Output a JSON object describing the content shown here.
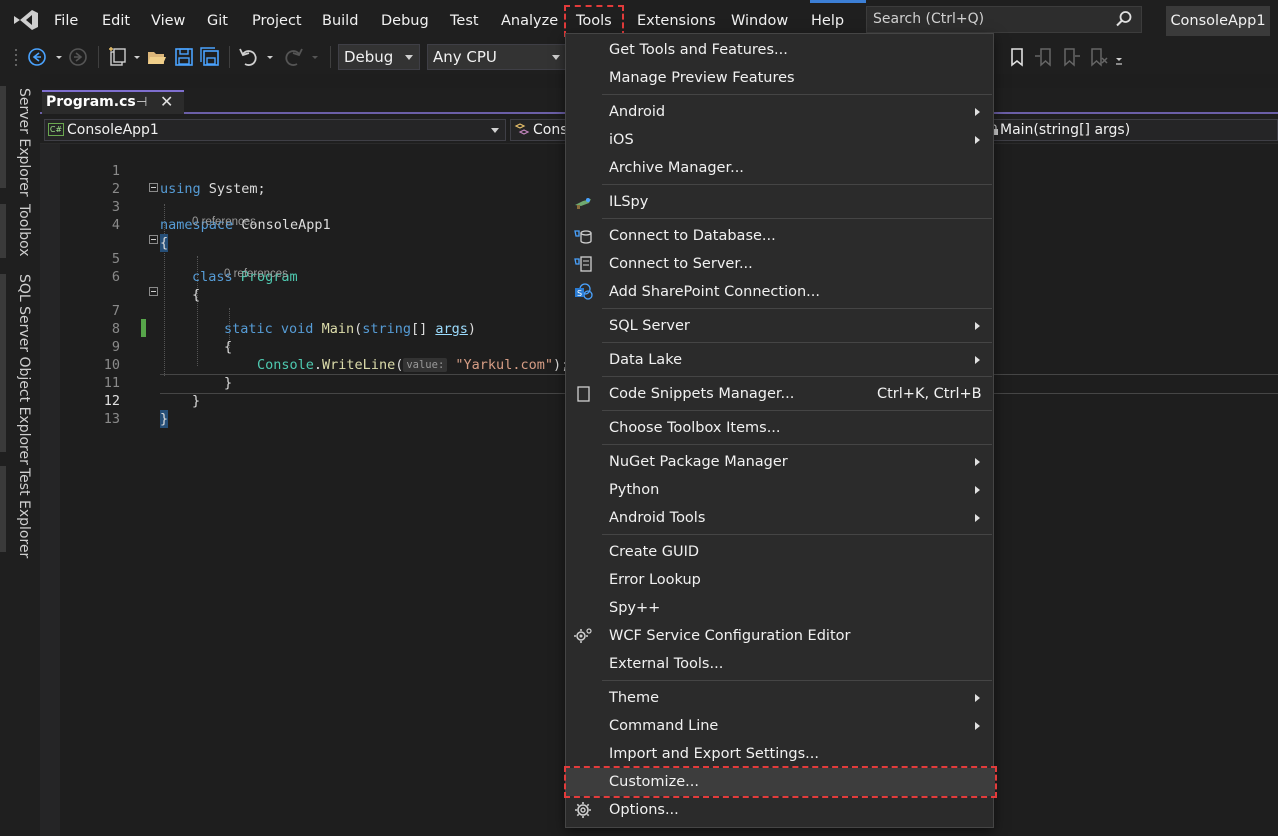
{
  "menubar": {
    "items": [
      "File",
      "Edit",
      "View",
      "Git",
      "Project",
      "Build",
      "Debug",
      "Test",
      "Analyze",
      "Tools",
      "Extensions",
      "Window",
      "Help"
    ],
    "search_placeholder": "Search (Ctrl+Q)",
    "solution_name": "ConsoleApp1"
  },
  "toolbar": {
    "config": "Debug",
    "platform": "Any CPU"
  },
  "side_tabs": [
    "Server Explorer",
    "Toolbox",
    "SQL Server Object Explorer",
    "Test Explorer"
  ],
  "document_tab": {
    "title": "Program.cs"
  },
  "navbar": {
    "project": "ConsoleApp1",
    "type": "Consc",
    "member": "Main(string[] args)"
  },
  "editor": {
    "line_numbers": [
      "1",
      "2",
      "3",
      "4",
      "5",
      "6",
      "7",
      "8",
      "9",
      "10",
      "11",
      "12",
      "13"
    ],
    "codelens": "0 references",
    "hint_label": "value:",
    "lines": {
      "l1_kw": "using",
      "l1_rest": " System;",
      "l3_kw": "namespace",
      "l3_rest": " ConsoleApp1",
      "l4": "{",
      "l5_kw": "class",
      "l5_type": "Program",
      "l6": "{",
      "l7_kw1": "static",
      "l7_kw2": "void",
      "l7_fn": "Main",
      "l7_p1": "(",
      "l7_kw3": "string",
      "l7_p2": "[] ",
      "l7_pm": "args",
      "l7_p3": ")",
      "l8": "{",
      "l9_ty": "Console",
      "l9_dot": ".",
      "l9_fn": "WriteLine",
      "l9_p1": "(",
      "l9_str": "\"Yarkul.com\"",
      "l9_p2": ");",
      "l10": "}",
      "l11": "}",
      "l12": "}"
    }
  },
  "tools_menu": {
    "get_tools": "Get Tools and Features...",
    "manage_preview": "Manage Preview Features",
    "android": "Android",
    "ios": "iOS",
    "archive": "Archive Manager...",
    "ilspy": "ILSpy",
    "connect_db": "Connect to Database...",
    "connect_server": "Connect to Server...",
    "sharepoint": "Add SharePoint Connection...",
    "sql_server": "SQL Server",
    "data_lake": "Data Lake",
    "snippets": "Code Snippets Manager...",
    "snippets_shortcut": "Ctrl+K, Ctrl+B",
    "toolbox_items": "Choose Toolbox Items...",
    "nuget": "NuGet Package Manager",
    "python": "Python",
    "android_tools": "Android Tools",
    "guid": "Create GUID",
    "error_lookup": "Error Lookup",
    "spy": "Spy++",
    "wcf": "WCF Service Configuration Editor",
    "external_tools": "External Tools...",
    "theme": "Theme",
    "command_line": "Command Line",
    "import_export": "Import and Export Settings...",
    "customize": "Customize...",
    "options": "Options..."
  },
  "colors": {
    "highlight_dashed": "#e23b3b",
    "accent": "#7f6fcf",
    "keyword": "#569cd6",
    "type": "#4ec9b0",
    "string": "#d69d85"
  }
}
